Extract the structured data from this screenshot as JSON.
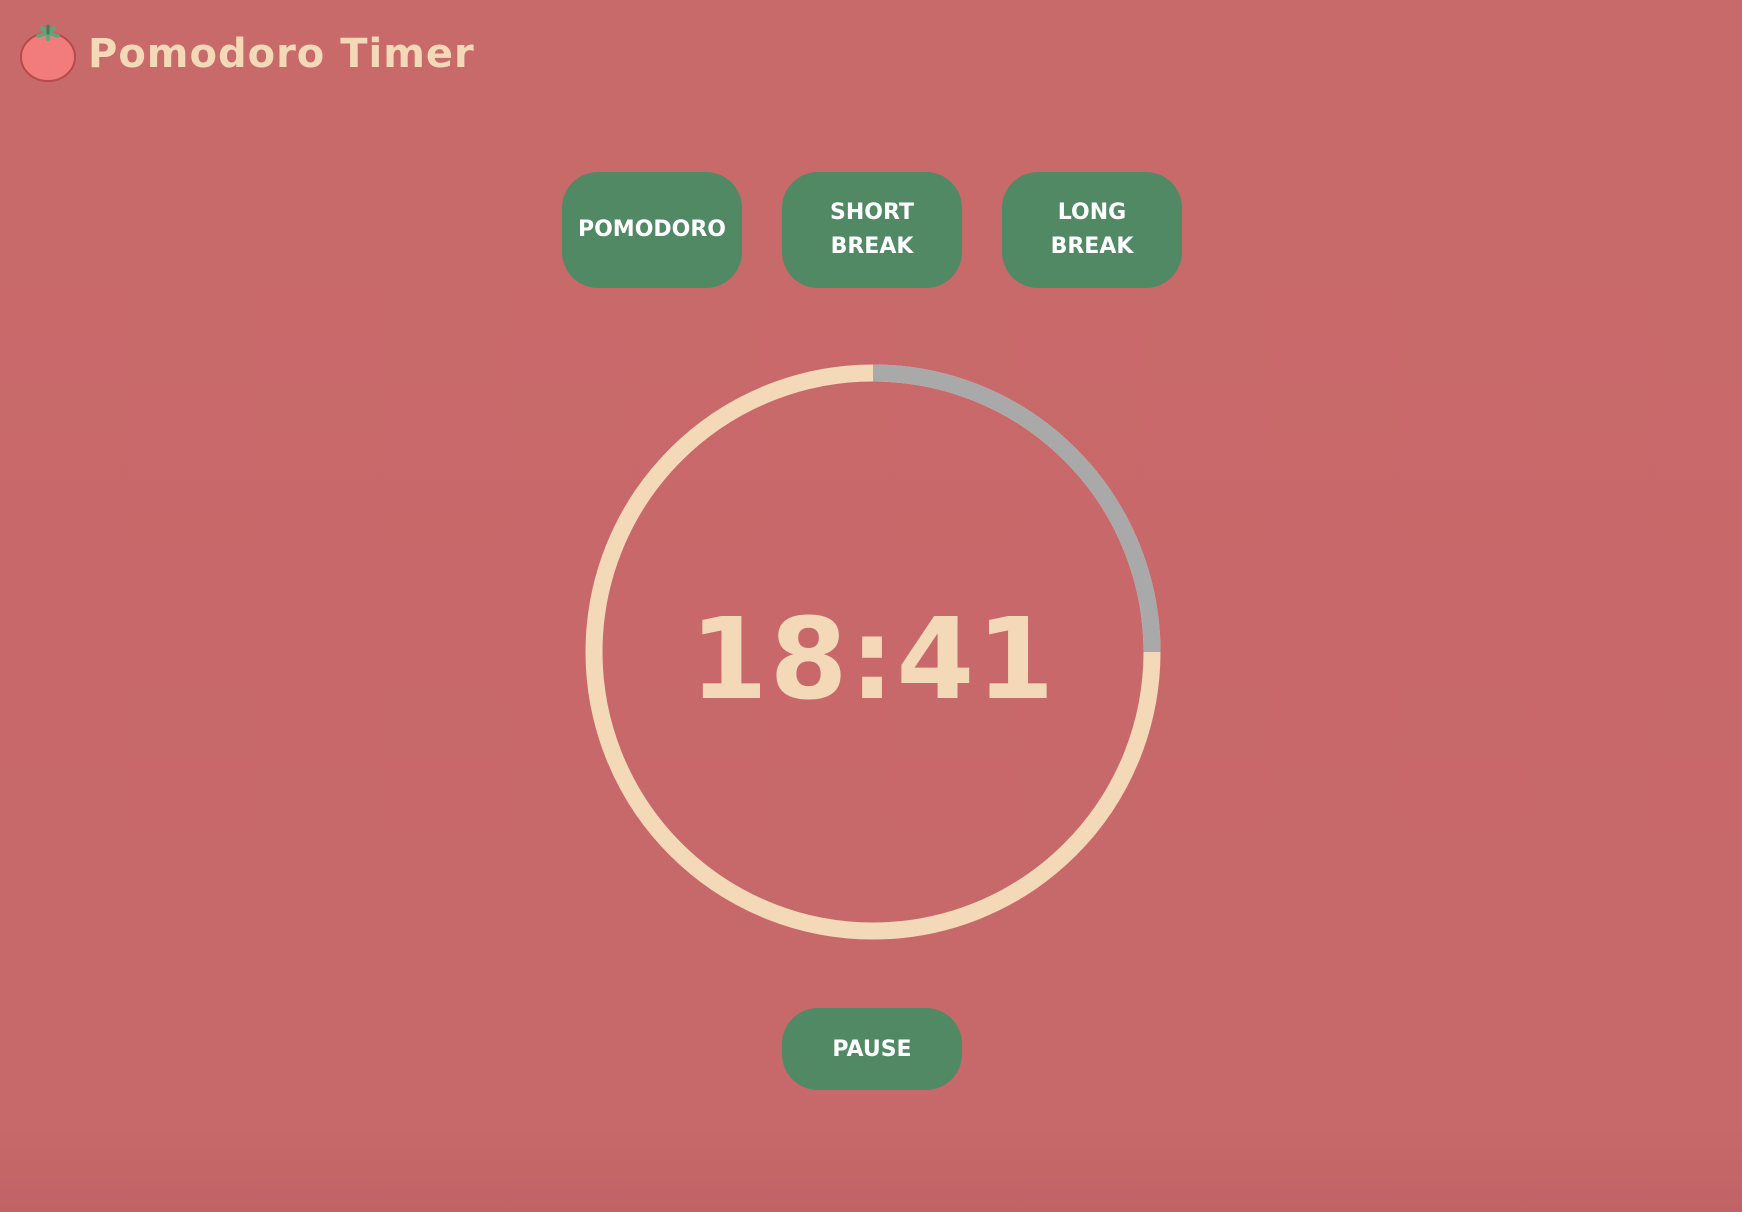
{
  "header": {
    "title": "Pomodoro Timer",
    "logo_icon": "tomato-icon"
  },
  "modes": [
    {
      "label_line1": "POMODORO",
      "label_line2": ""
    },
    {
      "label_line1": "SHORT",
      "label_line2": "BREAK"
    },
    {
      "label_line1": "LONG",
      "label_line2": "BREAK"
    }
  ],
  "timer": {
    "display": "18:41",
    "elapsed_fraction": 0.25
  },
  "controls": {
    "pause_label": "PAUSE"
  },
  "colors": {
    "background": "#c7686a",
    "button": "#508964",
    "button_text": "#ffffff",
    "accent": "#f3d9b8",
    "ring_elapsed": "#a9a9a9"
  }
}
